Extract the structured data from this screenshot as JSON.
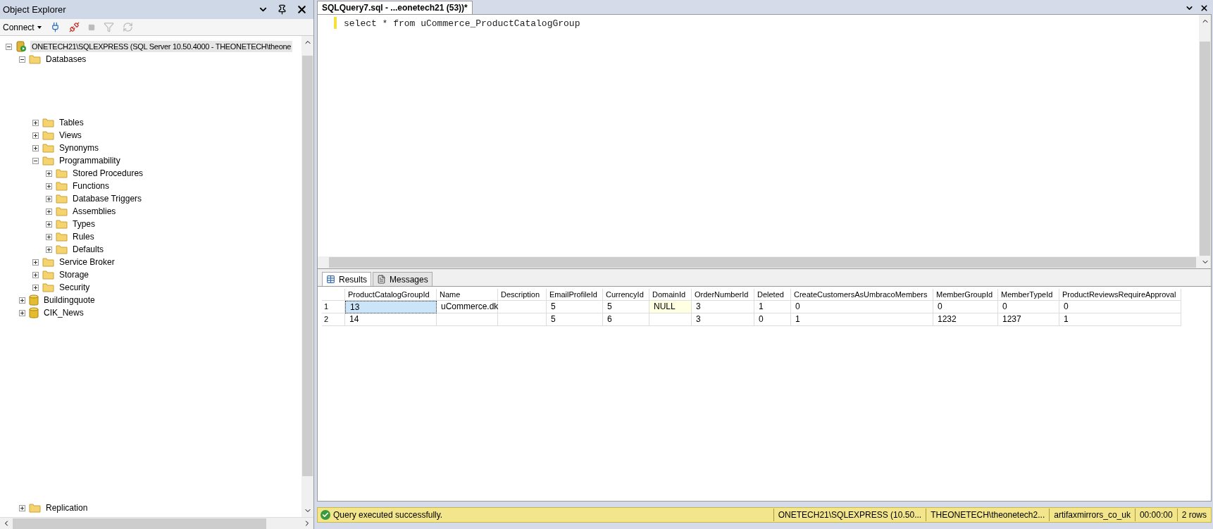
{
  "object_explorer": {
    "title": "Object Explorer",
    "connect_label": "Connect",
    "tree": [
      {
        "label": "ONETECH21\\SQLEXPRESS (SQL Server 10.50.4000 - THEONETECH\\theone",
        "kind": "server",
        "expanded": true,
        "selected": true,
        "children": [
          {
            "label": "Databases",
            "kind": "folder",
            "expanded": true,
            "selected": false,
            "children": [
              {
                "label": "Tables",
                "kind": "folder",
                "expanded": false,
                "selected": false
              },
              {
                "label": "Views",
                "kind": "folder",
                "expanded": false,
                "selected": false
              },
              {
                "label": "Synonyms",
                "kind": "folder",
                "expanded": false,
                "selected": false
              },
              {
                "label": "Programmability",
                "kind": "folder",
                "expanded": true,
                "selected": false,
                "children": [
                  {
                    "label": "Stored Procedures",
                    "kind": "folder",
                    "expanded": false,
                    "selected": false
                  },
                  {
                    "label": "Functions",
                    "kind": "folder",
                    "expanded": false,
                    "selected": false
                  },
                  {
                    "label": "Database Triggers",
                    "kind": "folder",
                    "expanded": false,
                    "selected": false
                  },
                  {
                    "label": "Assemblies",
                    "kind": "folder",
                    "expanded": false,
                    "selected": false
                  },
                  {
                    "label": "Types",
                    "kind": "folder",
                    "expanded": false,
                    "selected": false
                  },
                  {
                    "label": "Rules",
                    "kind": "folder",
                    "expanded": false,
                    "selected": false
                  },
                  {
                    "label": "Defaults",
                    "kind": "folder",
                    "expanded": false,
                    "selected": false
                  }
                ]
              },
              {
                "label": "Service Broker",
                "kind": "folder",
                "expanded": false,
                "selected": false
              },
              {
                "label": "Storage",
                "kind": "folder",
                "expanded": false,
                "selected": false
              },
              {
                "label": "Security",
                "kind": "folder",
                "expanded": false,
                "selected": false
              }
            ]
          },
          {
            "label": "Buildingquote",
            "kind": "database",
            "expanded": false,
            "selected": false
          },
          {
            "label": "CIK_News",
            "kind": "database",
            "expanded": false,
            "selected": false
          },
          {
            "label": "Replication",
            "kind": "folder",
            "expanded": false,
            "selected": false
          }
        ]
      }
    ]
  },
  "query_tab": {
    "title": "SQLQuery7.sql - ...eonetech21 (53))*"
  },
  "editor": {
    "code": "select * from uCommerce_ProductCatalogGroup"
  },
  "result_tabs": [
    {
      "label": "Results",
      "selected": true
    },
    {
      "label": "Messages",
      "selected": false
    }
  ],
  "results": {
    "columns": [
      "ProductCatalogGroupId",
      "Name",
      "Description",
      "EmailProfileId",
      "CurrencyId",
      "DomainId",
      "OrderNumberId",
      "Deleted",
      "CreateCustomersAsUmbracoMembers",
      "MemberGroupId",
      "MemberTypeId",
      "ProductReviewsRequireApproval"
    ],
    "rows": [
      {
        "number": "1",
        "cells": [
          {
            "kind": "value",
            "text": "13",
            "selected": true
          },
          {
            "kind": "value",
            "text": "uCommerce.dk",
            "selected": false
          },
          {
            "kind": "blank",
            "selected": false
          },
          {
            "kind": "value",
            "text": "5",
            "selected": false
          },
          {
            "kind": "value",
            "text": "5",
            "selected": false
          },
          {
            "kind": "null",
            "text": "NULL",
            "selected": false
          },
          {
            "kind": "value",
            "text": "3",
            "selected": false
          },
          {
            "kind": "value",
            "text": "1",
            "selected": false
          },
          {
            "kind": "value",
            "text": "0",
            "selected": false
          },
          {
            "kind": "value",
            "text": "0",
            "selected": false
          },
          {
            "kind": "value",
            "text": "0",
            "selected": false
          },
          {
            "kind": "value",
            "text": "0",
            "selected": false
          }
        ]
      },
      {
        "number": "2",
        "cells": [
          {
            "kind": "value",
            "text": "14",
            "selected": false
          },
          {
            "kind": "blank",
            "selected": false
          },
          {
            "kind": "blank",
            "selected": false
          },
          {
            "kind": "value",
            "text": "5",
            "selected": false
          },
          {
            "kind": "value",
            "text": "6",
            "selected": false
          },
          {
            "kind": "blank",
            "selected": false
          },
          {
            "kind": "value",
            "text": "3",
            "selected": false
          },
          {
            "kind": "value",
            "text": "0",
            "selected": false
          },
          {
            "kind": "value",
            "text": "1",
            "selected": false
          },
          {
            "kind": "value",
            "text": "1232",
            "selected": false
          },
          {
            "kind": "value",
            "text": "1237",
            "selected": false
          },
          {
            "kind": "value",
            "text": "1",
            "selected": false
          }
        ]
      }
    ]
  },
  "status_bar": {
    "message": "Query executed successfully.",
    "segments": [
      "ONETECH21\\SQLEXPRESS (10.50...",
      "THEONETECH\\theonetech2...",
      "artifaxmirrors_co_uk",
      "00:00:00",
      "2 rows"
    ]
  }
}
